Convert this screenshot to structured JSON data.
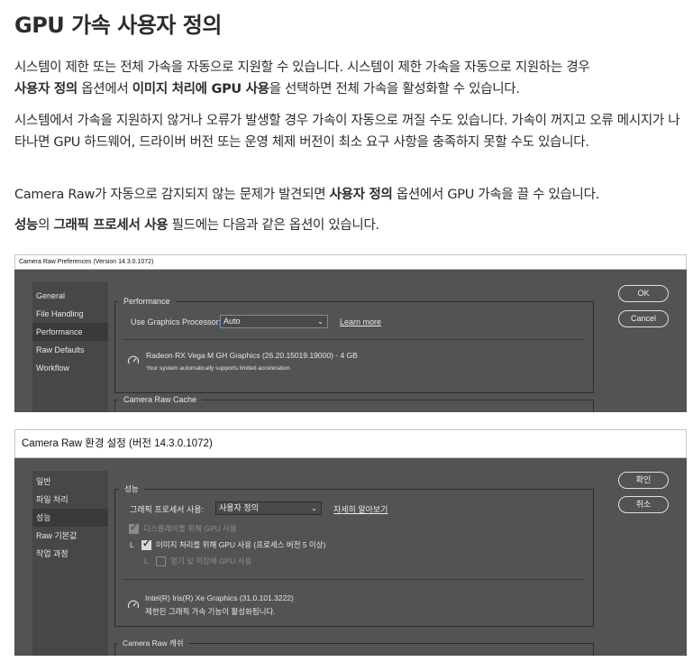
{
  "article": {
    "title": "GPU 가속 사용자 정의",
    "p1": {
      "t1": "시스템이 제한 또는 전체 가속을 자동으로 지원할 수 있습니다. 시스템이 제한 가속을 자동으로 지원하는 경우",
      "b1": "사용자 정의",
      "t2": " 옵션에서 ",
      "b2": "이미지 처리에 GPU 사용",
      "t3": "을 선택하면 전체 가속을 활성화할 수 있습니다."
    },
    "p2": "시스템에서 가속을 지원하지 않거나 오류가 발생할 경우 가속이 자동으로 꺼질 수도 있습니다. 가속이 꺼지고 오류 메시지가 나타나면 GPU 하드웨어, 드라이버 버전 또는 운영 체제 버전이 최소 요구 사항을 충족하지 못할 수도 있습니다.",
    "p3": {
      "t1": "Camera Raw가 자동으로 감지되지 않는 문제가 발견되면 ",
      "b1": "사용자 정의",
      "t2": " 옵션에서 GPU 가속을 끌 수 있습니다."
    },
    "p4": {
      "b1": "성능",
      "t1": "의 ",
      "b2": "그래픽 프로세서 사용",
      "t2": " 필드에는 다음과 같은 옵션이 있습니다."
    }
  },
  "shot_en": {
    "window_title": "Camera Raw Preferences  (Version 14.3.0.1072)",
    "sidebar": [
      "General",
      "File Handling",
      "Performance",
      "Raw Defaults",
      "Workflow"
    ],
    "active_index": 2,
    "group_title": "Performance",
    "gpu_label": "Use Graphics Processor:",
    "gpu_value": "Auto",
    "learn_more": "Learn more",
    "gpu_name": "Radeon RX Vega M GH Graphics (26.20.15019.19000) - 4 GB",
    "gpu_status": "Your system automatically supports limited acceleration.",
    "cache_title": "Camera Raw Cache",
    "ok": "OK",
    "cancel": "Cancel"
  },
  "shot_ko": {
    "window_title": "Camera Raw 환경 설정  (버전 14.3.0.1072)",
    "sidebar": [
      "일반",
      "파일 처리",
      "성능",
      "Raw 기본값",
      "작업 과정"
    ],
    "active_index": 2,
    "group_title": "성능",
    "gpu_label": "그래픽 프로세서 사용:",
    "gpu_value": "사용자 정의",
    "learn_more": "자세히 알아보기",
    "opt_display": "디스플레이를 위해 GPU 사용",
    "opt_image_prefix": "L",
    "opt_image": "이미지 처리를 위해 GPU 사용 (프로세스 버전 5 이상)",
    "opt_export_prefix": "L",
    "opt_export": "열기 및 저장에 GPU 사용",
    "gpu_name": "Intel(R) Iris(R) Xe Graphics (31.0.101.3222)",
    "gpu_status": "제한된 그래픽 가속 기능이 활성화됩니다.",
    "cache_title": "Camera Raw 캐쉬",
    "ok": "확인",
    "cancel": "취소"
  }
}
